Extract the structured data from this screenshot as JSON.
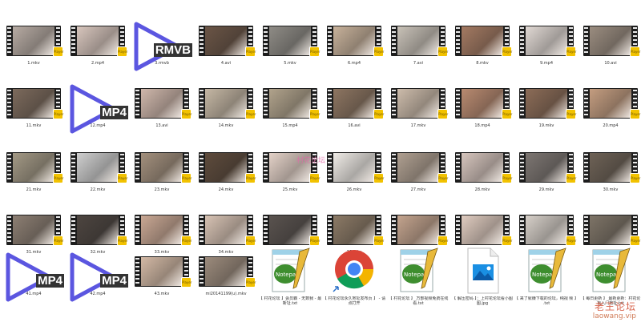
{
  "files": [
    {
      "label": "1.mkv",
      "kind": "video",
      "tone": "#b7aba3"
    },
    {
      "label": "2.mp4",
      "kind": "video",
      "tone": "#d8c6bd"
    },
    {
      "label": "3.rmvb",
      "kind": "player",
      "tag": "RMVB"
    },
    {
      "label": "4.avi",
      "kind": "video",
      "tone": "#6b5546"
    },
    {
      "label": "5.mkv",
      "kind": "video",
      "tone": "#8f8c86"
    },
    {
      "label": "6.mp4",
      "kind": "video",
      "tone": "#c8b29b"
    },
    {
      "label": "7.avi",
      "kind": "video",
      "tone": "#c9c2b8"
    },
    {
      "label": "8.mkv",
      "kind": "video",
      "tone": "#a47a62"
    },
    {
      "label": "9.mp4",
      "kind": "video",
      "tone": "#e1d9d4"
    },
    {
      "label": "10.avi",
      "kind": "video",
      "tone": "#9b8d80"
    },
    {
      "label": "11.mkv",
      "kind": "video",
      "tone": "#7c6a5c"
    },
    {
      "label": "12.mp4",
      "kind": "player",
      "tag": "MP4"
    },
    {
      "label": "13.avi",
      "kind": "video",
      "tone": "#cfb7ab"
    },
    {
      "label": "14.mkv",
      "kind": "video",
      "tone": "#c5b7a4"
    },
    {
      "label": "15.mp4",
      "kind": "video",
      "tone": "#b1a38c"
    },
    {
      "label": "16.avi",
      "kind": "video",
      "tone": "#8d7561"
    },
    {
      "label": "17.mkv",
      "kind": "video",
      "tone": "#cdbcab"
    },
    {
      "label": "18.mp4",
      "kind": "video",
      "tone": "#b98a70"
    },
    {
      "label": "19.mkv",
      "kind": "video",
      "tone": "#8c6c57"
    },
    {
      "label": "20.mp4",
      "kind": "video",
      "tone": "#c49d80"
    },
    {
      "label": "21.mkv",
      "kind": "video",
      "tone": "#a39985"
    },
    {
      "label": "22.mkv",
      "kind": "video",
      "tone": "#cfcfcf"
    },
    {
      "label": "23.mkv",
      "kind": "video",
      "tone": "#a3907d"
    },
    {
      "label": "24.mkv",
      "kind": "video",
      "tone": "#5e4b3c"
    },
    {
      "label": "25.mkv",
      "kind": "video",
      "tone": "#e4d2c8"
    },
    {
      "label": "26.mkv",
      "kind": "video",
      "tone": "#f0ece7"
    },
    {
      "label": "27.mkv",
      "kind": "video",
      "tone": "#b0a091"
    },
    {
      "label": "28.mkv",
      "kind": "video",
      "tone": "#d6c5bd"
    },
    {
      "label": "29.mkv",
      "kind": "video",
      "tone": "#7d7672"
    },
    {
      "label": "30.mkv",
      "kind": "video",
      "tone": "#6e6256"
    },
    {
      "label": "31.mkv",
      "kind": "video",
      "tone": "#8d7f73"
    },
    {
      "label": "32.mkv",
      "kind": "video",
      "tone": "#4d4540"
    },
    {
      "label": "33.mkv",
      "kind": "video",
      "tone": "#caa894"
    },
    {
      "label": "34.mkv",
      "kind": "video",
      "tone": "#d8c3b4"
    },
    {
      "label": "35.mkv",
      "kind": "video",
      "tone": "#5a534f"
    },
    {
      "label": "36.mkv",
      "kind": "video",
      "tone": "#8c7a66"
    },
    {
      "label": "37.mkv",
      "kind": "video",
      "tone": "#c4a48e"
    },
    {
      "label": "38.mkv",
      "kind": "video",
      "tone": "#e0ccc0"
    },
    {
      "label": "39.mkv",
      "kind": "video",
      "tone": "#d7d0c9"
    },
    {
      "label": "40.avi",
      "kind": "video",
      "tone": "#7e7467"
    },
    {
      "label": "41.mp4",
      "kind": "player",
      "tag": "MP4"
    },
    {
      "label": "42.mp4",
      "kind": "player",
      "tag": "MP4"
    },
    {
      "label": "43.mkv",
      "kind": "video",
      "tone": "#d3b9a5"
    },
    {
      "label": "mi20141199(u).mkv",
      "kind": "video",
      "tone": "#9c8b7c"
    },
    {
      "label": "【 村花论坛 】会员霸 - 无数我 - 最新址.txt",
      "kind": "notepad"
    },
    {
      "label": "【 村花论坛永久地址发布页 】 - 请点打开",
      "kind": "chrome"
    },
    {
      "label": "【 村花论坛 】 万部视频免费在线看.txt",
      "kind": "notepad"
    },
    {
      "label": "【 解压密码 】：上村花论坛看小图图.jpg",
      "kind": "image"
    },
    {
      "label": "【 来了就赚下载的论坛，纯视 频 】 .txt",
      "kind": "notepad"
    },
    {
      "label": "【 每日更新 】 最新更新：村花论 坛入门地址.txt",
      "kind": "notepad"
    }
  ],
  "watermark": {
    "line1": "老王论坛",
    "line2": "laowang.vip"
  },
  "stamp": "村花论坛",
  "badge_text": "Player"
}
